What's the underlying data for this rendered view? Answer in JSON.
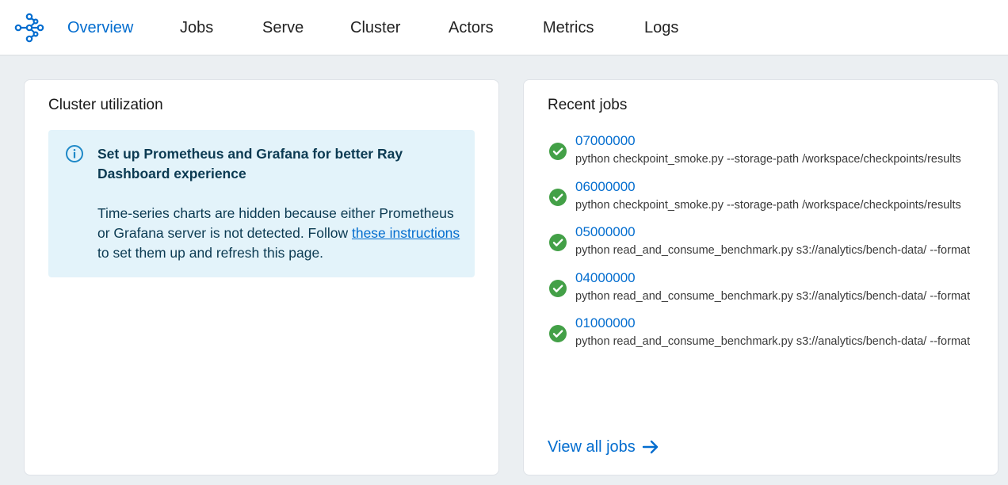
{
  "nav": {
    "items": [
      {
        "label": "Overview",
        "active": true
      },
      {
        "label": "Jobs"
      },
      {
        "label": "Serve"
      },
      {
        "label": "Cluster"
      },
      {
        "label": "Actors"
      },
      {
        "label": "Metrics"
      },
      {
        "label": "Logs"
      }
    ],
    "logo_icon": "ray-logo-icon"
  },
  "cluster_utilization": {
    "title": "Cluster utilization",
    "info": {
      "icon": "info-icon",
      "title": "Set up Prometheus and Grafana for better Ray Dashboard experience",
      "body_before": "Time-series charts are hidden because either Prometheus or Grafana server is not detected. Follow ",
      "link_text": "these instructions",
      "body_after": " to set them up and refresh this page."
    }
  },
  "recent_jobs": {
    "title": "Recent jobs",
    "jobs": [
      {
        "id": "07000000",
        "command": "python checkpoint_smoke.py --storage-path /workspace/checkpoints/results",
        "status": "succeeded"
      },
      {
        "id": "06000000",
        "command": "python checkpoint_smoke.py --storage-path /workspace/checkpoints/results",
        "status": "succeeded"
      },
      {
        "id": "05000000",
        "command": "python read_and_consume_benchmark.py s3://analytics/bench-data/ --format",
        "status": "succeeded"
      },
      {
        "id": "04000000",
        "command": "python read_and_consume_benchmark.py s3://analytics/bench-data/ --format",
        "status": "succeeded"
      },
      {
        "id": "01000000",
        "command": "python read_and_consume_benchmark.py s3://analytics/bench-data/ --format",
        "status": "succeeded"
      }
    ],
    "view_all_label": "View all jobs"
  },
  "colors": {
    "accent": "#036DCF",
    "success": "#43A047",
    "info_bg": "#E3F3FA",
    "page_bg": "#EBEFF2"
  }
}
